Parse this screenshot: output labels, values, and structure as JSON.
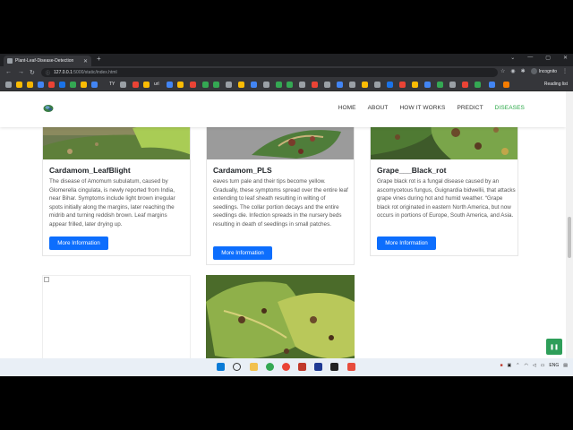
{
  "browser": {
    "tab_title": "Plant-Leaf-Disease-Detection",
    "url_host": "127.0.0.1",
    "url_path": ":5000/static/index.html",
    "profile_label": "Incognito",
    "reading_list": "Reading list",
    "bookmark_label_a": "TY",
    "bookmark_label_b": "url"
  },
  "navbar": {
    "links": [
      "HOME",
      "ABOUT",
      "HOW IT WORKS",
      "PREDICT",
      "DISEASES"
    ],
    "active": "DISEASES"
  },
  "cards": [
    {
      "title": "Cardamom_LeafBlight",
      "description": "The disease of Amomum subulatum, caused by Glomerella cingulata, is newly reported from India, near Bihar. Symptoms include light brown irregular spots initially along the margins, later reaching the midrib and turning reddish brown. Leaf margins appear frilled, later drying up.",
      "button": "More Information"
    },
    {
      "title": "Cardamom_PLS",
      "description": "eaves turn pale and their tips become yellow. Gradually, these symptoms spread over the entire leaf extending to leaf sheath resulting in wilting of seedlings. The collar portion decays and the entire seedlings die. Infection spreads in the nursery beds resulting in death of seedlings in small patches.",
      "button": "More Information"
    },
    {
      "title": "Grape___Black_rot",
      "description": "Grape black rot is a fungal disease caused by an ascomycetous fungus, Guignardia bidwellii, that attacks grape vines during hot and humid weather. “Grape black rot originated in eastern North America, but now occurs in portions of Europe, South America, and Asia.",
      "button": "More Information"
    }
  ],
  "taskbar": {
    "lang": "ENG"
  }
}
